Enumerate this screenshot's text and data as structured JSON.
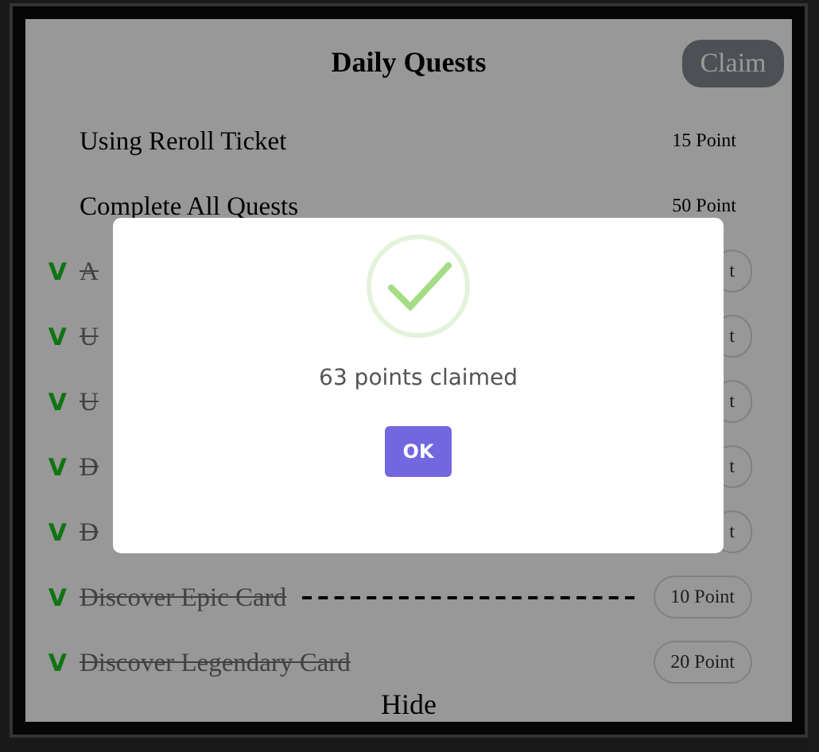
{
  "panel": {
    "title": "Daily Quests",
    "claim_button": {
      "label": "Claim",
      "disabled": true
    },
    "quests": [
      {
        "name": "Using Reroll Ticket",
        "points": "15 Point",
        "completed": false,
        "dashed": false
      },
      {
        "name": "Complete All Quests",
        "points": "50 Point",
        "completed": false,
        "dashed": false
      },
      {
        "mark": "V",
        "name": "A",
        "points": "t",
        "completed": true,
        "dashed": false
      },
      {
        "mark": "V",
        "name": "U",
        "points": "t",
        "completed": true,
        "dashed": false
      },
      {
        "mark": "V",
        "name": "U",
        "points": "t",
        "completed": true,
        "dashed": false
      },
      {
        "mark": "V",
        "name": "D",
        "points": "t",
        "completed": true,
        "dashed": false
      },
      {
        "mark": "V",
        "name": "D",
        "points": "t",
        "completed": true,
        "dashed": false
      },
      {
        "mark": "V",
        "name": "Discover Epic Card",
        "points": "10 Point",
        "completed": true,
        "dashed": true
      },
      {
        "mark": "V",
        "name": "Discover Legendary Card",
        "points": "20 Point",
        "completed": true,
        "dashed": false
      }
    ],
    "hide_button": "Hide"
  },
  "dialog": {
    "message": "63 points claimed",
    "ok_button": "OK"
  }
}
